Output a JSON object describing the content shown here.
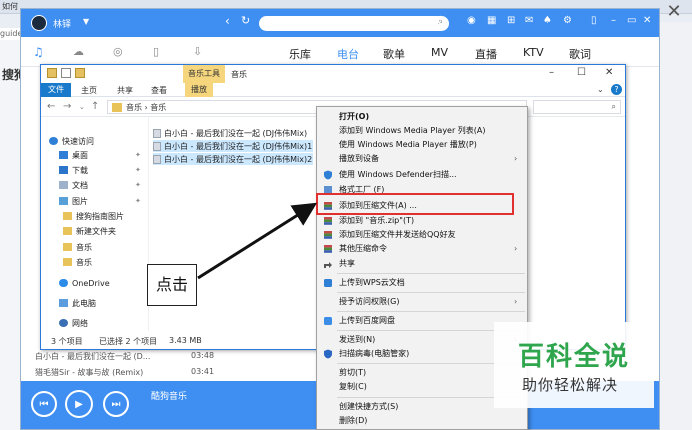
{
  "background": {
    "browser_tab": "如何",
    "address_fragment": "guide",
    "left_text": "搜狗",
    "close_glyph": "✕"
  },
  "kugou": {
    "username": "林铎",
    "nav": [
      "乐库",
      "电台",
      "歌单",
      "MV",
      "直播",
      "KTV",
      "歌词"
    ],
    "nav_active": "电台",
    "list": [
      {
        "title": "白小白 - 最后我们没在一起 (D...",
        "time": "03:48"
      },
      {
        "title": "猎毛猎Sir - 故事与故 (Remix)",
        "time": "03:41"
      }
    ],
    "now_playing": "酷狗音乐",
    "accent": "#3f8ff2"
  },
  "explorer": {
    "contextual_tab": "音乐工具",
    "title": "音乐",
    "ribbon_tabs": [
      "文件",
      "主页",
      "共享",
      "查看",
      "播放"
    ],
    "breadcrumb": "音乐  ›  音乐",
    "nav_items": [
      "快速访问",
      "桌面",
      "下载",
      "文档",
      "图片",
      "搜狗指南图片",
      "新建文件夹",
      "音乐",
      "音乐",
      "OneDrive",
      "此电脑",
      "网络"
    ],
    "files": [
      "白小白 - 最后我们没在一起 (DJ伟伟Mix)",
      "白小白 - 最后我们没在一起 (DJ伟伟Mix)1",
      "白小白 - 最后我们没在一起 (DJ伟伟Mix)2"
    ],
    "status": {
      "count": "3 个项目",
      "selected": "已选择 2 个项目",
      "size": "3.43 MB"
    }
  },
  "context_menu": {
    "items": [
      {
        "label": "打开(O)",
        "bold": true
      },
      {
        "label": "添加到 Windows Media Player 列表(A)"
      },
      {
        "label": "使用 Windows Media Player 播放(P)"
      },
      {
        "label": "播放到设备",
        "submenu": true
      },
      {
        "label": "使用 Windows Defender扫描...",
        "icon": "shield-icon"
      },
      {
        "label": "格式工厂 (F)",
        "icon": "format-factory-icon"
      },
      {
        "label": "添加到压缩文件(A) ...",
        "icon": "archive-icon",
        "highlight": true
      },
      {
        "label": "添加到 \"音乐.zip\"(T)",
        "icon": "archive-icon"
      },
      {
        "label": "添加到压缩文件并发送给QQ好友",
        "icon": "archive-icon"
      },
      {
        "label": "其他压缩命令",
        "icon": "archive-icon",
        "submenu": true
      },
      {
        "label": "共享",
        "icon": "share-icon"
      },
      {
        "label": "上传到WPS云文档",
        "icon": "cloud-upload-icon"
      },
      {
        "label": "授予访问权限(G)",
        "submenu": true
      },
      {
        "label": "上传到百度网盘",
        "icon": "baidu-cloud-icon"
      },
      {
        "label": "发送到(N)",
        "submenu": true
      },
      {
        "label": "扫描病毒(电脑管家)",
        "icon": "antivirus-icon"
      },
      {
        "label": "剪切(T)"
      },
      {
        "label": "复制(C)"
      },
      {
        "label": "创建快捷方式(S)"
      },
      {
        "label": "删除(D)"
      }
    ]
  },
  "annotation": {
    "callout": "点击"
  },
  "watermark": {
    "title": "百科全说",
    "subtitle": "助你轻松解决"
  },
  "colors": {
    "highlight_box": "#e03030",
    "explorer_accent": "#1979ca",
    "watermark_green": "#2fa54d"
  }
}
